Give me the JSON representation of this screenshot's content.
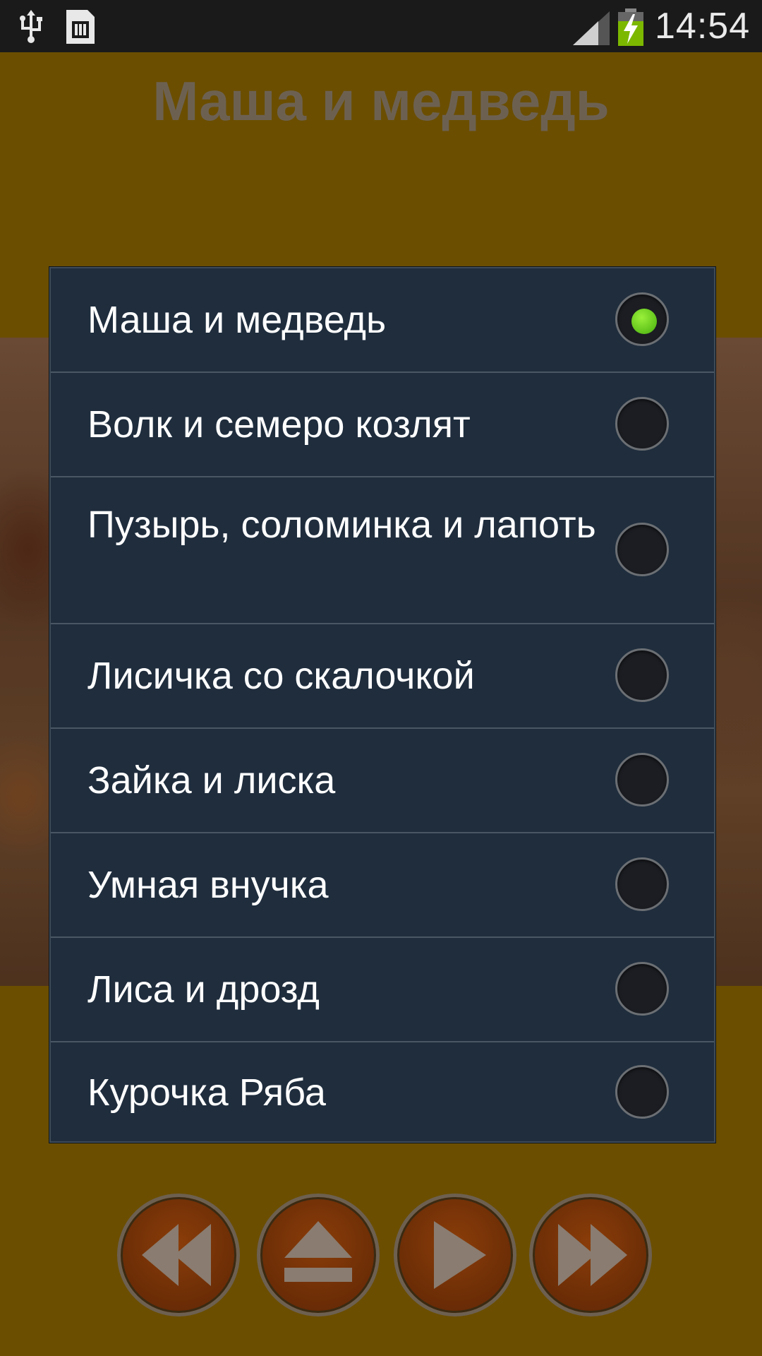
{
  "status_bar": {
    "time": "14:54",
    "icons": [
      "usb-icon",
      "sim-card-icon",
      "signal-icon",
      "battery-charging-icon"
    ]
  },
  "app": {
    "title": "Маша и медведь",
    "controls": [
      "rewind-icon",
      "eject-icon",
      "play-icon",
      "fast-forward-icon"
    ]
  },
  "dialog": {
    "selected_index": 0,
    "items": [
      {
        "label": "Маша и медведь",
        "selected": true
      },
      {
        "label": "Волк и семеро козлят",
        "selected": false
      },
      {
        "label": "Пузырь, соломинка и лапоть",
        "selected": false
      },
      {
        "label": "Лисичка со скалочкой",
        "selected": false
      },
      {
        "label": "Зайка и лиска",
        "selected": false
      },
      {
        "label": "Умная внучка",
        "selected": false
      },
      {
        "label": "Лиса и дрозд",
        "selected": false
      },
      {
        "label": "Курочка Ряба",
        "selected": false
      }
    ]
  },
  "colors": {
    "app_background": "#6b4e00",
    "dialog_background": "#1f2d3d",
    "radio_selected": "#5fc21a",
    "title_text": "#6c6151"
  }
}
